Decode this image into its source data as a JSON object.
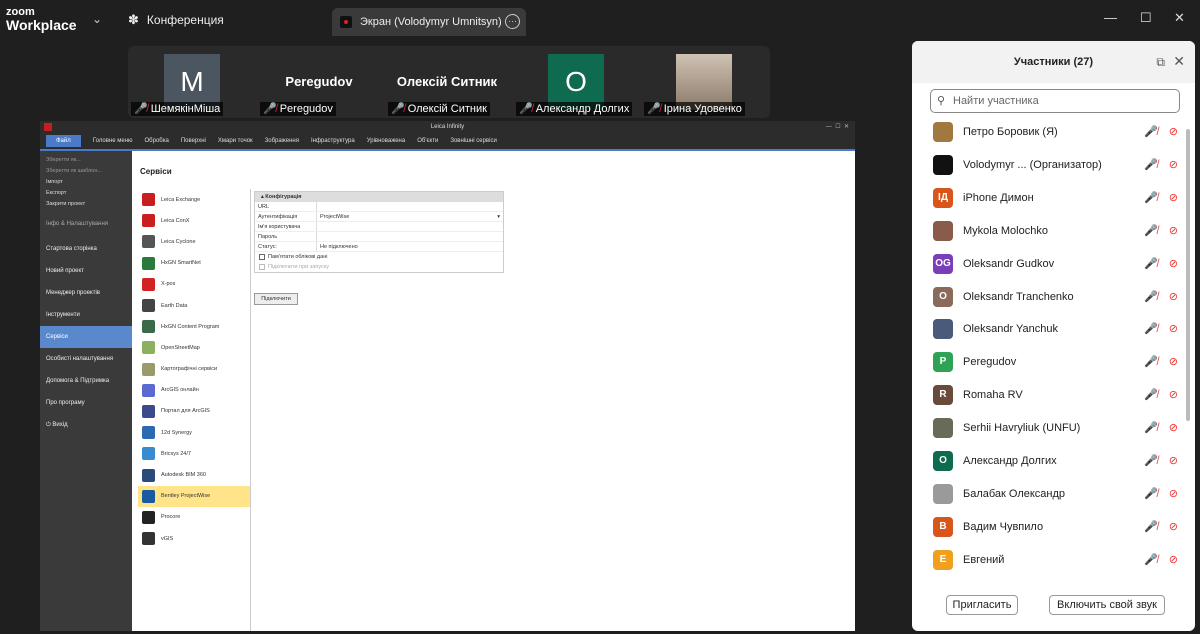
{
  "titlebar": {
    "logo_line1": "zoom",
    "logo_line2": "Workplace",
    "meeting_tab": "Конференция",
    "share_tab": "Экран (Volodymyr Umnitsyn)"
  },
  "video_strip": [
    {
      "avatar_letter": "M",
      "avatar_color": "#4c5660",
      "name": "ШемякінМіша"
    },
    {
      "big_name": "Peregudov",
      "name": "Peregudov"
    },
    {
      "big_name": "Олексій Ситник",
      "name": "Олексій Ситник"
    },
    {
      "avatar_letter": "O",
      "avatar_color": "#0f6b4f",
      "name": "Александр Долгих"
    },
    {
      "photo": "avatar-photo",
      "name": "Ірина Удовенко"
    }
  ],
  "leica": {
    "window_title": "Leica Infinity",
    "menu": [
      "Файл",
      "Головне меню",
      "Обробка",
      "Поверхні",
      "Хмари точок",
      "Зображення",
      "Інфраструктура",
      "Урівноважена",
      "Об'єкти",
      "Зовнішні сервіси"
    ],
    "side_actions": [
      "Зберегти як...",
      "Зберегти як шаблон...",
      "Імпорт",
      "Експорт",
      "Закрити проект"
    ],
    "side_info": "Інфо & Налаштування",
    "side_menu": [
      "Стартова сторінка",
      "Новий проект",
      "Менеджер проектів",
      "Інструменти",
      "Сервіси",
      "Особисті налаштування",
      "Допомога & Підтримка",
      "Про програму"
    ],
    "side_exit": "Вихід",
    "services_title": "Сервіси",
    "services": [
      {
        "label": "Leica Exchange",
        "color": "#c81e1e"
      },
      {
        "label": "Leica ConX",
        "color": "#c81e1e"
      },
      {
        "label": "Leica Cyclone",
        "color": "#555555"
      },
      {
        "label": "HxGN SmartNet",
        "color": "#2a7a3a"
      },
      {
        "label": "X-pos",
        "color": "#d32222"
      },
      {
        "label": "Earth Data",
        "color": "#444444"
      },
      {
        "label": "HxGN Content Program",
        "color": "#3a6a4a"
      },
      {
        "label": "OpenStreetMap",
        "color": "#8ab060"
      },
      {
        "label": "Картографічні сервіси",
        "color": "#9a9a6a"
      },
      {
        "label": "ArcGIS онлайн",
        "color": "#5a6ad0"
      },
      {
        "label": "Портал для ArcGIS",
        "color": "#3a4a8a"
      },
      {
        "label": "12d Synergy",
        "color": "#2a6ab0"
      },
      {
        "label": "Bricsys 24/7",
        "color": "#3a8ad0"
      },
      {
        "label": "Autodesk BIM 360",
        "color": "#2a4a7a"
      },
      {
        "label": "Bentley ProjectWise",
        "color": "#1a5aa0"
      },
      {
        "label": "Procore",
        "color": "#222222"
      },
      {
        "label": "vGIS",
        "color": "#333333"
      }
    ],
    "config": {
      "header": "Конфігурація",
      "rows": [
        {
          "k": "URL",
          "v": ""
        },
        {
          "k": "Аутентифікація",
          "v": "ProjectWise"
        },
        {
          "k": "Ім'я користувача",
          "v": ""
        },
        {
          "k": "Пароль",
          "v": ""
        },
        {
          "k": "Статус:",
          "v": "Не підключено"
        }
      ],
      "remember": "Пам'ятати облікові дані",
      "autoconnect": "Підключити при запуску",
      "connect_button": "Підключити"
    }
  },
  "panel": {
    "title": "Участники (27)",
    "search_placeholder": "Найти участника",
    "participants": [
      {
        "name": "Петро Боровик (Я)",
        "letter": "",
        "color": "#a07840"
      },
      {
        "name": "Volodymyr ...  (Организатор)",
        "letter": "",
        "color": "#111111"
      },
      {
        "name": "iPhone Димон",
        "letter": "IД",
        "color": "#d9561a"
      },
      {
        "name": "Mykola Molochko",
        "letter": "",
        "color": "#8a5a4a"
      },
      {
        "name": "Oleksandr Gudkov",
        "letter": "OG",
        "color": "#7a3fb8"
      },
      {
        "name": "Oleksandr Tranchenko",
        "letter": "O",
        "color": "#8a6a5a"
      },
      {
        "name": "Oleksandr Yanchuk",
        "letter": "",
        "color": "#4a5a7a"
      },
      {
        "name": "Peregudov",
        "letter": "P",
        "color": "#2ea356"
      },
      {
        "name": "Romaha RV",
        "letter": "R",
        "color": "#6a4a3a"
      },
      {
        "name": "Serhii Havryliuk (UNFU)",
        "letter": "",
        "color": "#6a6a5a"
      },
      {
        "name": "Александр Долгих",
        "letter": "O",
        "color": "#0f6b4f"
      },
      {
        "name": "Балабак Олександр",
        "letter": "",
        "color": "#9a9a9a"
      },
      {
        "name": "Вадим Чувпило",
        "letter": "B",
        "color": "#d9561a"
      },
      {
        "name": "Евгений",
        "letter": "E",
        "color": "#f0a020"
      }
    ],
    "invite_button": "Пригласить",
    "unmute_button": "Включить свой звук"
  }
}
